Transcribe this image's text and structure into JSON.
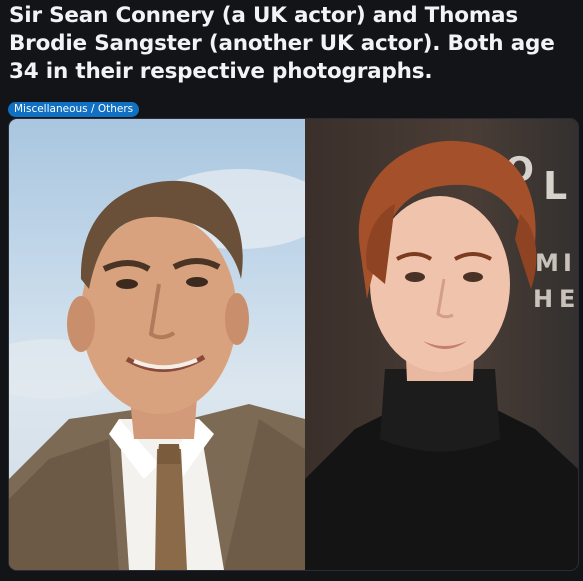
{
  "post": {
    "title": "Sir Sean Connery (a UK actor) and Thomas Brodie Sangster (another UK actor). Both age 34 in their respective photographs.",
    "flair": "Miscellaneous / Others"
  },
  "media": {
    "left_photo": "photo",
    "right_photo": "photo",
    "right_photo_backdrop_letters": [
      "O",
      "L",
      "M",
      "I",
      "H",
      "E"
    ]
  }
}
